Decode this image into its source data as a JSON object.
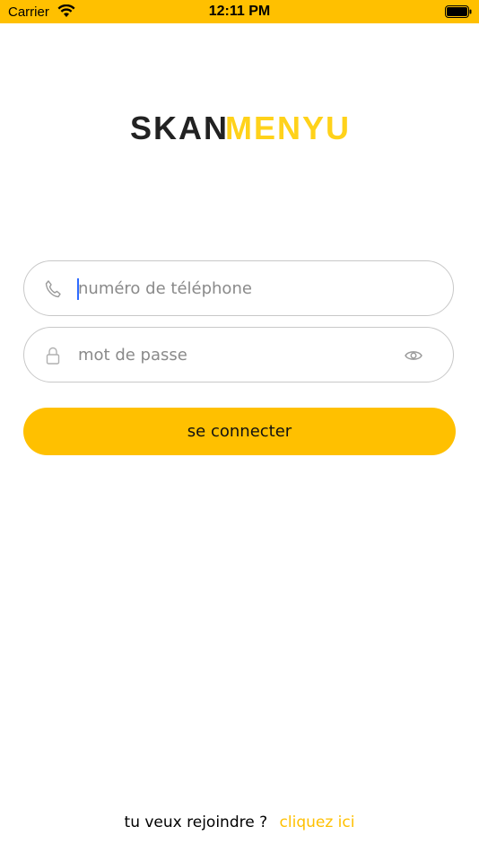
{
  "status_bar": {
    "carrier": "Carrier",
    "time": "12:11 PM",
    "background": "#FFC000"
  },
  "logo": {
    "part1": "SKAN",
    "part2": "MENYU",
    "part1_color": "#222222",
    "part2_color": "#FFD21A"
  },
  "form": {
    "phone": {
      "placeholder": "numéro de téléphone",
      "icon": "phone-icon"
    },
    "password": {
      "placeholder": "mot de passe",
      "icon": "lock-icon",
      "toggle_icon": "eye-icon"
    },
    "login_label": "se connecter"
  },
  "footer": {
    "question": "tu veux rejoindre ?",
    "link": "cliquez ici"
  },
  "colors": {
    "accent": "#FFC000",
    "caret": "#2F6BFF"
  }
}
